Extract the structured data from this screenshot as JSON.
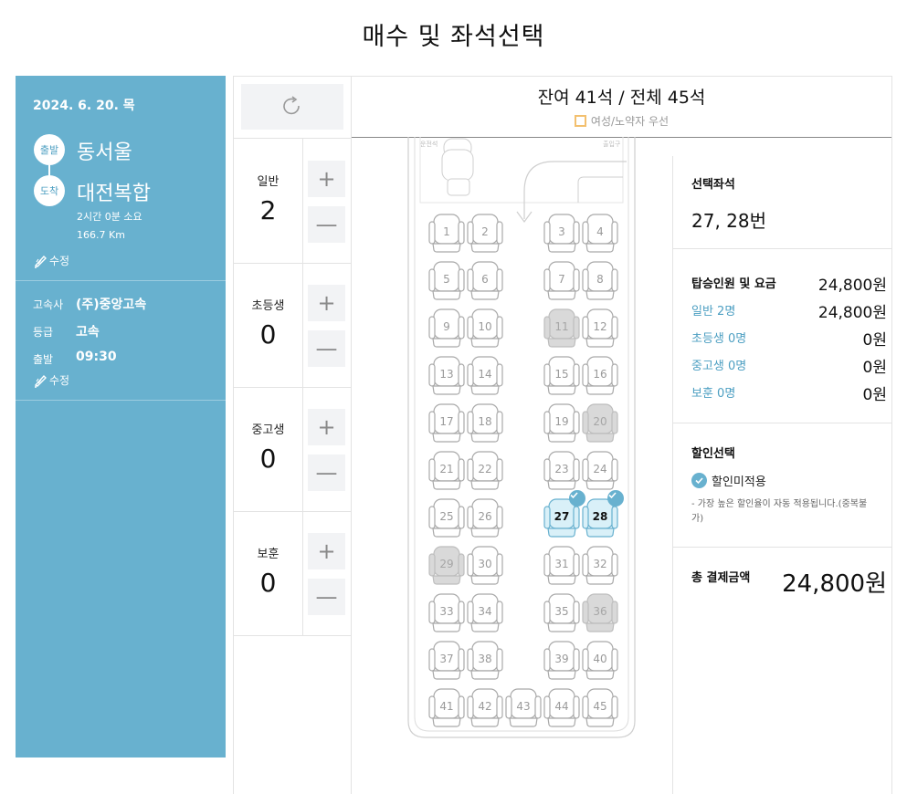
{
  "page_title": "매수 및 좌석선택",
  "sidebar": {
    "date": "2024. 6. 20. 목",
    "depart_badge": "출발",
    "depart_terminal": "동서울",
    "arrive_badge": "도착",
    "arrive_terminal": "대전복합",
    "duration": "2시간 0분 소요",
    "distance": "166.7 Km",
    "edit_label": "수정",
    "company_key": "고속사",
    "company_val": "(주)중앙고속",
    "grade_key": "등급",
    "grade_val": "고속",
    "depart_key": "출발",
    "depart_time": "09:30",
    "edit_label_2": "수정"
  },
  "header": {
    "seat_count": "잔여 41석 / 전체 45석",
    "legend": "여성/노약자 우선"
  },
  "passengers": [
    {
      "label": "일반",
      "count": "2"
    },
    {
      "label": "초등생",
      "count": "0"
    },
    {
      "label": "중고생",
      "count": "0"
    },
    {
      "label": "보훈",
      "count": "0"
    }
  ],
  "controls": {
    "plus": "+",
    "minus": "—"
  },
  "bus": {
    "front_left": "운전석",
    "front_right": "출입구",
    "seats": [
      {
        "n": "1",
        "s": "available"
      },
      {
        "n": "2",
        "s": "available"
      },
      {
        "n": "3",
        "s": "available"
      },
      {
        "n": "4",
        "s": "available"
      },
      {
        "n": "5",
        "s": "available"
      },
      {
        "n": "6",
        "s": "available"
      },
      {
        "n": "7",
        "s": "available"
      },
      {
        "n": "8",
        "s": "available"
      },
      {
        "n": "9",
        "s": "available"
      },
      {
        "n": "10",
        "s": "available"
      },
      {
        "n": "11",
        "s": "sold"
      },
      {
        "n": "12",
        "s": "available"
      },
      {
        "n": "13",
        "s": "available"
      },
      {
        "n": "14",
        "s": "available"
      },
      {
        "n": "15",
        "s": "available"
      },
      {
        "n": "16",
        "s": "available"
      },
      {
        "n": "17",
        "s": "available"
      },
      {
        "n": "18",
        "s": "available"
      },
      {
        "n": "19",
        "s": "available"
      },
      {
        "n": "20",
        "s": "sold"
      },
      {
        "n": "21",
        "s": "available"
      },
      {
        "n": "22",
        "s": "available"
      },
      {
        "n": "23",
        "s": "available"
      },
      {
        "n": "24",
        "s": "available"
      },
      {
        "n": "25",
        "s": "available"
      },
      {
        "n": "26",
        "s": "available"
      },
      {
        "n": "27",
        "s": "selected"
      },
      {
        "n": "28",
        "s": "selected"
      },
      {
        "n": "29",
        "s": "sold"
      },
      {
        "n": "30",
        "s": "available"
      },
      {
        "n": "31",
        "s": "available"
      },
      {
        "n": "32",
        "s": "available"
      },
      {
        "n": "33",
        "s": "available"
      },
      {
        "n": "34",
        "s": "available"
      },
      {
        "n": "35",
        "s": "available"
      },
      {
        "n": "36",
        "s": "sold"
      },
      {
        "n": "37",
        "s": "available"
      },
      {
        "n": "38",
        "s": "available"
      },
      {
        "n": "39",
        "s": "available"
      },
      {
        "n": "40",
        "s": "available"
      },
      {
        "n": "41",
        "s": "available"
      },
      {
        "n": "42",
        "s": "available"
      },
      {
        "n": "43",
        "s": "available"
      },
      {
        "n": "44",
        "s": "available"
      },
      {
        "n": "45",
        "s": "available"
      }
    ]
  },
  "summary": {
    "selected_title": "선택좌석",
    "selected_seats": "27, 28번",
    "fare_title": "탑승인원 및 요금",
    "fare_total": "24,800원",
    "rows": [
      {
        "label": "일반 2명",
        "value": "24,800원"
      },
      {
        "label": "초등생 0명",
        "value": "0원"
      },
      {
        "label": "중고생 0명",
        "value": "0원"
      },
      {
        "label": "보훈 0명",
        "value": "0원"
      }
    ],
    "discount_title": "할인선택",
    "discount_option": "할인미적용",
    "discount_note": "- 가장 높은 할인율이 자동 적용됩니다.(중복불가)",
    "total_title": "총 결제금액",
    "total_value": "24,800원"
  },
  "colors": {
    "accent": "#68b1cf",
    "seat_available": "#ffffff",
    "seat_sold": "#d9d9d9",
    "seat_selected": "#d9f0f8",
    "legend_border": "#f3c06f"
  }
}
